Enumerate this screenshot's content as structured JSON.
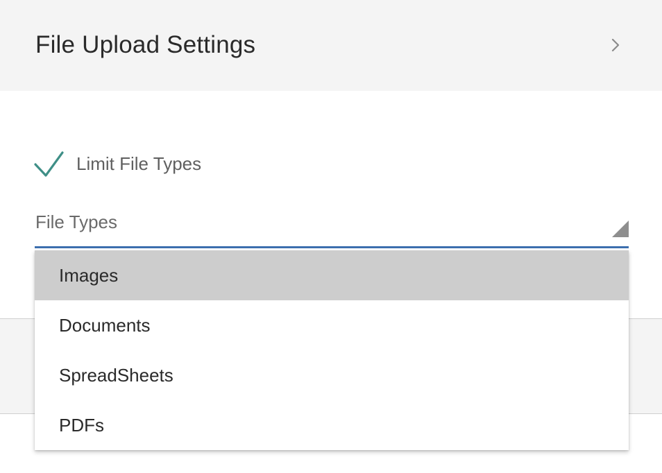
{
  "header": {
    "title": "File Upload Settings",
    "expand_icon": "chevron-right-icon"
  },
  "limit_file_types": {
    "label": "Limit File Types",
    "checked": true,
    "check_icon": "checkmark-icon",
    "check_color": "#3f8f87"
  },
  "file_types_select": {
    "label": "File Types",
    "underline_color": "#3d6fae",
    "arrow_icon": "dropdown-triangle-icon"
  },
  "dropdown": {
    "highlighted_index": 0,
    "options": [
      {
        "label": "Images"
      },
      {
        "label": "Documents"
      },
      {
        "label": "SpreadSheets"
      },
      {
        "label": "PDFs"
      }
    ]
  }
}
